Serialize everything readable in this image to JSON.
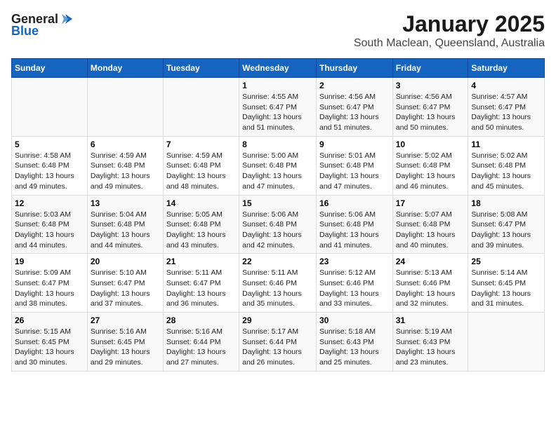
{
  "header": {
    "logo_line1": "General",
    "logo_line2": "Blue",
    "title": "January 2025",
    "subtitle": "South Maclean, Queensland, Australia"
  },
  "calendar": {
    "columns": [
      "Sunday",
      "Monday",
      "Tuesday",
      "Wednesday",
      "Thursday",
      "Friday",
      "Saturday"
    ],
    "weeks": [
      [
        {
          "day": "",
          "info": ""
        },
        {
          "day": "",
          "info": ""
        },
        {
          "day": "",
          "info": ""
        },
        {
          "day": "1",
          "info": "Sunrise: 4:55 AM\nSunset: 6:47 PM\nDaylight: 13 hours\nand 51 minutes."
        },
        {
          "day": "2",
          "info": "Sunrise: 4:56 AM\nSunset: 6:47 PM\nDaylight: 13 hours\nand 51 minutes."
        },
        {
          "day": "3",
          "info": "Sunrise: 4:56 AM\nSunset: 6:47 PM\nDaylight: 13 hours\nand 50 minutes."
        },
        {
          "day": "4",
          "info": "Sunrise: 4:57 AM\nSunset: 6:47 PM\nDaylight: 13 hours\nand 50 minutes."
        }
      ],
      [
        {
          "day": "5",
          "info": "Sunrise: 4:58 AM\nSunset: 6:48 PM\nDaylight: 13 hours\nand 49 minutes."
        },
        {
          "day": "6",
          "info": "Sunrise: 4:59 AM\nSunset: 6:48 PM\nDaylight: 13 hours\nand 49 minutes."
        },
        {
          "day": "7",
          "info": "Sunrise: 4:59 AM\nSunset: 6:48 PM\nDaylight: 13 hours\nand 48 minutes."
        },
        {
          "day": "8",
          "info": "Sunrise: 5:00 AM\nSunset: 6:48 PM\nDaylight: 13 hours\nand 47 minutes."
        },
        {
          "day": "9",
          "info": "Sunrise: 5:01 AM\nSunset: 6:48 PM\nDaylight: 13 hours\nand 47 minutes."
        },
        {
          "day": "10",
          "info": "Sunrise: 5:02 AM\nSunset: 6:48 PM\nDaylight: 13 hours\nand 46 minutes."
        },
        {
          "day": "11",
          "info": "Sunrise: 5:02 AM\nSunset: 6:48 PM\nDaylight: 13 hours\nand 45 minutes."
        }
      ],
      [
        {
          "day": "12",
          "info": "Sunrise: 5:03 AM\nSunset: 6:48 PM\nDaylight: 13 hours\nand 44 minutes."
        },
        {
          "day": "13",
          "info": "Sunrise: 5:04 AM\nSunset: 6:48 PM\nDaylight: 13 hours\nand 44 minutes."
        },
        {
          "day": "14",
          "info": "Sunrise: 5:05 AM\nSunset: 6:48 PM\nDaylight: 13 hours\nand 43 minutes."
        },
        {
          "day": "15",
          "info": "Sunrise: 5:06 AM\nSunset: 6:48 PM\nDaylight: 13 hours\nand 42 minutes."
        },
        {
          "day": "16",
          "info": "Sunrise: 5:06 AM\nSunset: 6:48 PM\nDaylight: 13 hours\nand 41 minutes."
        },
        {
          "day": "17",
          "info": "Sunrise: 5:07 AM\nSunset: 6:48 PM\nDaylight: 13 hours\nand 40 minutes."
        },
        {
          "day": "18",
          "info": "Sunrise: 5:08 AM\nSunset: 6:47 PM\nDaylight: 13 hours\nand 39 minutes."
        }
      ],
      [
        {
          "day": "19",
          "info": "Sunrise: 5:09 AM\nSunset: 6:47 PM\nDaylight: 13 hours\nand 38 minutes."
        },
        {
          "day": "20",
          "info": "Sunrise: 5:10 AM\nSunset: 6:47 PM\nDaylight: 13 hours\nand 37 minutes."
        },
        {
          "day": "21",
          "info": "Sunrise: 5:11 AM\nSunset: 6:47 PM\nDaylight: 13 hours\nand 36 minutes."
        },
        {
          "day": "22",
          "info": "Sunrise: 5:11 AM\nSunset: 6:46 PM\nDaylight: 13 hours\nand 35 minutes."
        },
        {
          "day": "23",
          "info": "Sunrise: 5:12 AM\nSunset: 6:46 PM\nDaylight: 13 hours\nand 33 minutes."
        },
        {
          "day": "24",
          "info": "Sunrise: 5:13 AM\nSunset: 6:46 PM\nDaylight: 13 hours\nand 32 minutes."
        },
        {
          "day": "25",
          "info": "Sunrise: 5:14 AM\nSunset: 6:45 PM\nDaylight: 13 hours\nand 31 minutes."
        }
      ],
      [
        {
          "day": "26",
          "info": "Sunrise: 5:15 AM\nSunset: 6:45 PM\nDaylight: 13 hours\nand 30 minutes."
        },
        {
          "day": "27",
          "info": "Sunrise: 5:16 AM\nSunset: 6:45 PM\nDaylight: 13 hours\nand 29 minutes."
        },
        {
          "day": "28",
          "info": "Sunrise: 5:16 AM\nSunset: 6:44 PM\nDaylight: 13 hours\nand 27 minutes."
        },
        {
          "day": "29",
          "info": "Sunrise: 5:17 AM\nSunset: 6:44 PM\nDaylight: 13 hours\nand 26 minutes."
        },
        {
          "day": "30",
          "info": "Sunrise: 5:18 AM\nSunset: 6:43 PM\nDaylight: 13 hours\nand 25 minutes."
        },
        {
          "day": "31",
          "info": "Sunrise: 5:19 AM\nSunset: 6:43 PM\nDaylight: 13 hours\nand 23 minutes."
        },
        {
          "day": "",
          "info": ""
        }
      ]
    ]
  }
}
